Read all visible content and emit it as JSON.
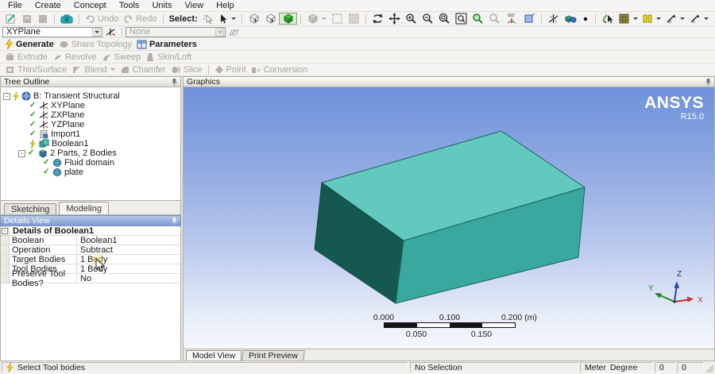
{
  "menu": [
    "File",
    "Create",
    "Concept",
    "Tools",
    "Units",
    "View",
    "Help"
  ],
  "toolbar": {
    "undo": "Undo",
    "redo": "Redo",
    "select_label": "Select:",
    "plane_combo": "XYPlane",
    "sketch_combo": "None"
  },
  "actions": {
    "generate": "Generate",
    "share_topology": "Share Topology",
    "parameters": "Parameters",
    "extrude": "Extrude",
    "revolve": "Revolve",
    "sweep": "Sweep",
    "skin_loft": "Skin/Loft",
    "thin_surface": "Thin/Surface",
    "blend": "Blend",
    "chamfer": "Chamfer",
    "slice": "Slice",
    "point": "Point",
    "conversion": "Conversion"
  },
  "tree": {
    "title": "Tree Outline",
    "items": [
      {
        "label": "B: Transient Structural"
      },
      {
        "label": "XYPlane"
      },
      {
        "label": "ZXPlane"
      },
      {
        "label": "YZPlane"
      },
      {
        "label": "Import1"
      },
      {
        "label": "Boolean1"
      },
      {
        "label": "2 Parts, 2 Bodies"
      },
      {
        "label": "Fluid domain"
      },
      {
        "label": "plate"
      }
    ]
  },
  "panel_tabs": {
    "sketching": "Sketching",
    "modeling": "Modeling"
  },
  "details": {
    "title": "Details View",
    "header": "Details of Boolean1",
    "rows": [
      {
        "label": "Boolean",
        "value": "Boolean1"
      },
      {
        "label": "Operation",
        "value": "Subtract"
      },
      {
        "label": "Target Bodies",
        "value": "1 Body"
      },
      {
        "label": "Tool Bodies",
        "value": "1 Body"
      },
      {
        "label": "Preserve Tool Bodies?",
        "value": "No"
      }
    ]
  },
  "graphics": {
    "title": "Graphics",
    "brand": "ANSYS",
    "version": "R15.0",
    "view_tabs": {
      "model": "Model View",
      "print": "Print Preview"
    },
    "triad": {
      "x": "X",
      "y": "Y",
      "z": "Z"
    },
    "ruler": {
      "t0": "0.000",
      "t1": "0.100",
      "t2": "0.200 (m)",
      "b0": "0.050",
      "b1": "0.150"
    }
  },
  "status": {
    "message": "Select Tool bodies",
    "selection": "No Selection",
    "unit_length": "Meter",
    "unit_angle": "Degree",
    "coord1": "0",
    "coord2": "0"
  },
  "colors": {
    "box_top": "#63C8BD",
    "box_left": "#14584F",
    "box_right": "#3AA89E",
    "box_edge": "#16655C",
    "viewport_top": "#6F92DB",
    "viewport_bottom": "#F5F8FD",
    "details_header": "#7D9BD0",
    "triad_x": "#C62F2F",
    "triad_y": "#1E8A1E",
    "triad_z": "#2244BB"
  }
}
